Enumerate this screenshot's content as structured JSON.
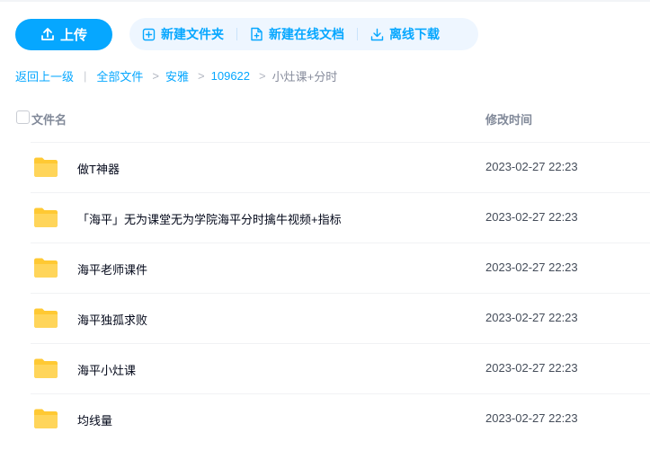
{
  "toolbar": {
    "upload_label": "上传",
    "actions": [
      {
        "label": "新建文件夹",
        "icon": "new-folder-icon"
      },
      {
        "label": "新建在线文档",
        "icon": "new-online-doc-icon"
      },
      {
        "label": "离线下载",
        "icon": "download-icon"
      }
    ]
  },
  "breadcrumb": {
    "back": "返回上一级",
    "separator": "|",
    "all_files": "全部文件",
    "chevron": ">",
    "path": [
      "安雅",
      "109622"
    ],
    "current": "小灶课+分时"
  },
  "table": {
    "headers": {
      "name": "文件名",
      "modified": "修改时间"
    },
    "rows": [
      {
        "name": "做T神器",
        "modified": "2023-02-27 22:23",
        "icon": "folder-icon"
      },
      {
        "name": "「海平」无为课堂无为学院海平分时擒牛视频+指标",
        "modified": "2023-02-27 22:23",
        "icon": "folder-icon"
      },
      {
        "name": "海平老师课件",
        "modified": "2023-02-27 22:23",
        "icon": "folder-icon"
      },
      {
        "name": "海平独孤求败",
        "modified": "2023-02-27 22:23",
        "icon": "folder-icon"
      },
      {
        "name": "海平小灶课",
        "modified": "2023-02-27 22:23",
        "icon": "folder-icon"
      },
      {
        "name": "均线量",
        "modified": "2023-02-27 22:23",
        "icon": "folder-icon"
      }
    ]
  },
  "colors": {
    "accent": "#06a7ff",
    "action_bg": "#eef6ff",
    "folder": "#ffc933"
  }
}
